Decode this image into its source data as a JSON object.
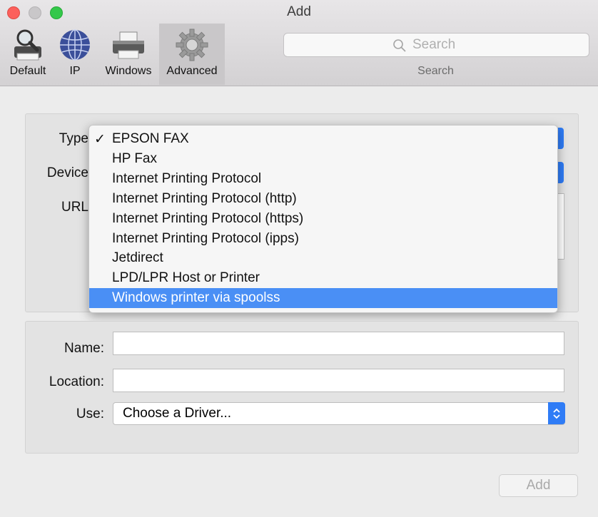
{
  "window": {
    "title": "Add",
    "traffic_lights": {
      "close": "#fc605c",
      "minimize": "#c9c7c9",
      "maximize": "#34c84a"
    }
  },
  "toolbar": {
    "items": [
      {
        "label": "Default",
        "icon": "magnifier-printer-icon"
      },
      {
        "label": "IP",
        "icon": "globe-icon"
      },
      {
        "label": "Windows",
        "icon": "printer-icon"
      },
      {
        "label": "Advanced",
        "icon": "gear-icon",
        "selected": true
      }
    ],
    "search": {
      "placeholder": "Search",
      "caption": "Search",
      "icon": "search-icon"
    }
  },
  "form_top": {
    "type_label": "Type",
    "device_label": "Device",
    "url_label": "URL"
  },
  "type_menu": {
    "selected": "EPSON FAX",
    "highlighted": "Windows printer via spoolss",
    "options": [
      "EPSON FAX",
      "HP Fax",
      "Internet Printing Protocol",
      "Internet Printing Protocol (http)",
      "Internet Printing Protocol (https)",
      "Internet Printing Protocol (ipps)",
      "Jetdirect",
      "LPD/LPR Host or Printer",
      "Windows printer via spoolss"
    ]
  },
  "form_bottom": {
    "name_label": "Name:",
    "name_value": "",
    "location_label": "Location:",
    "location_value": "",
    "use_label": "Use:",
    "use_value": "Choose a Driver..."
  },
  "footer": {
    "add_label": "Add"
  },
  "colors": {
    "accent": "#2f7cf6",
    "highlight": "#4a8ff5"
  }
}
